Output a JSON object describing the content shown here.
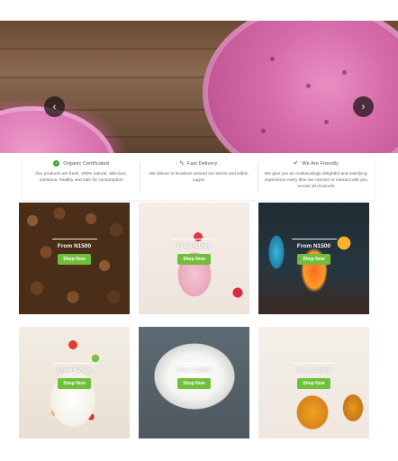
{
  "hero": {
    "prev_label": "‹",
    "next_label": "›",
    "dot_count": 3
  },
  "features": [
    {
      "icon": "check-circle-icon",
      "title": "Organic Certificated",
      "description": "Our products are fresh, 100% natural, delicious, nutritious, healthy and safe for consumption"
    },
    {
      "icon": "lightning-bolt-icon",
      "title": "Fast Delivery",
      "description": "We deliver to locations around our stores and within Lagos"
    },
    {
      "icon": "checkmark-icon",
      "title": "We Are Friendly",
      "description": "We give you an outstandingly delightful and satisfying experience every time we connect or interact with you across all channels"
    }
  ],
  "products": [
    {
      "price": "From N1500",
      "button": "Shop Now"
    },
    {
      "price": "From N1500",
      "button": "Shop Now"
    },
    {
      "price": "From N1500",
      "button": "Shop Now"
    },
    {
      "price": "From N2500",
      "button": "Shop Now"
    },
    {
      "price": "From N2500",
      "button": "Shop Now"
    },
    {
      "price": "From N2500",
      "button": "Shop Now"
    }
  ],
  "colors": {
    "accent_green": "#6fbf3a",
    "icon_green": "#3aa63a"
  }
}
